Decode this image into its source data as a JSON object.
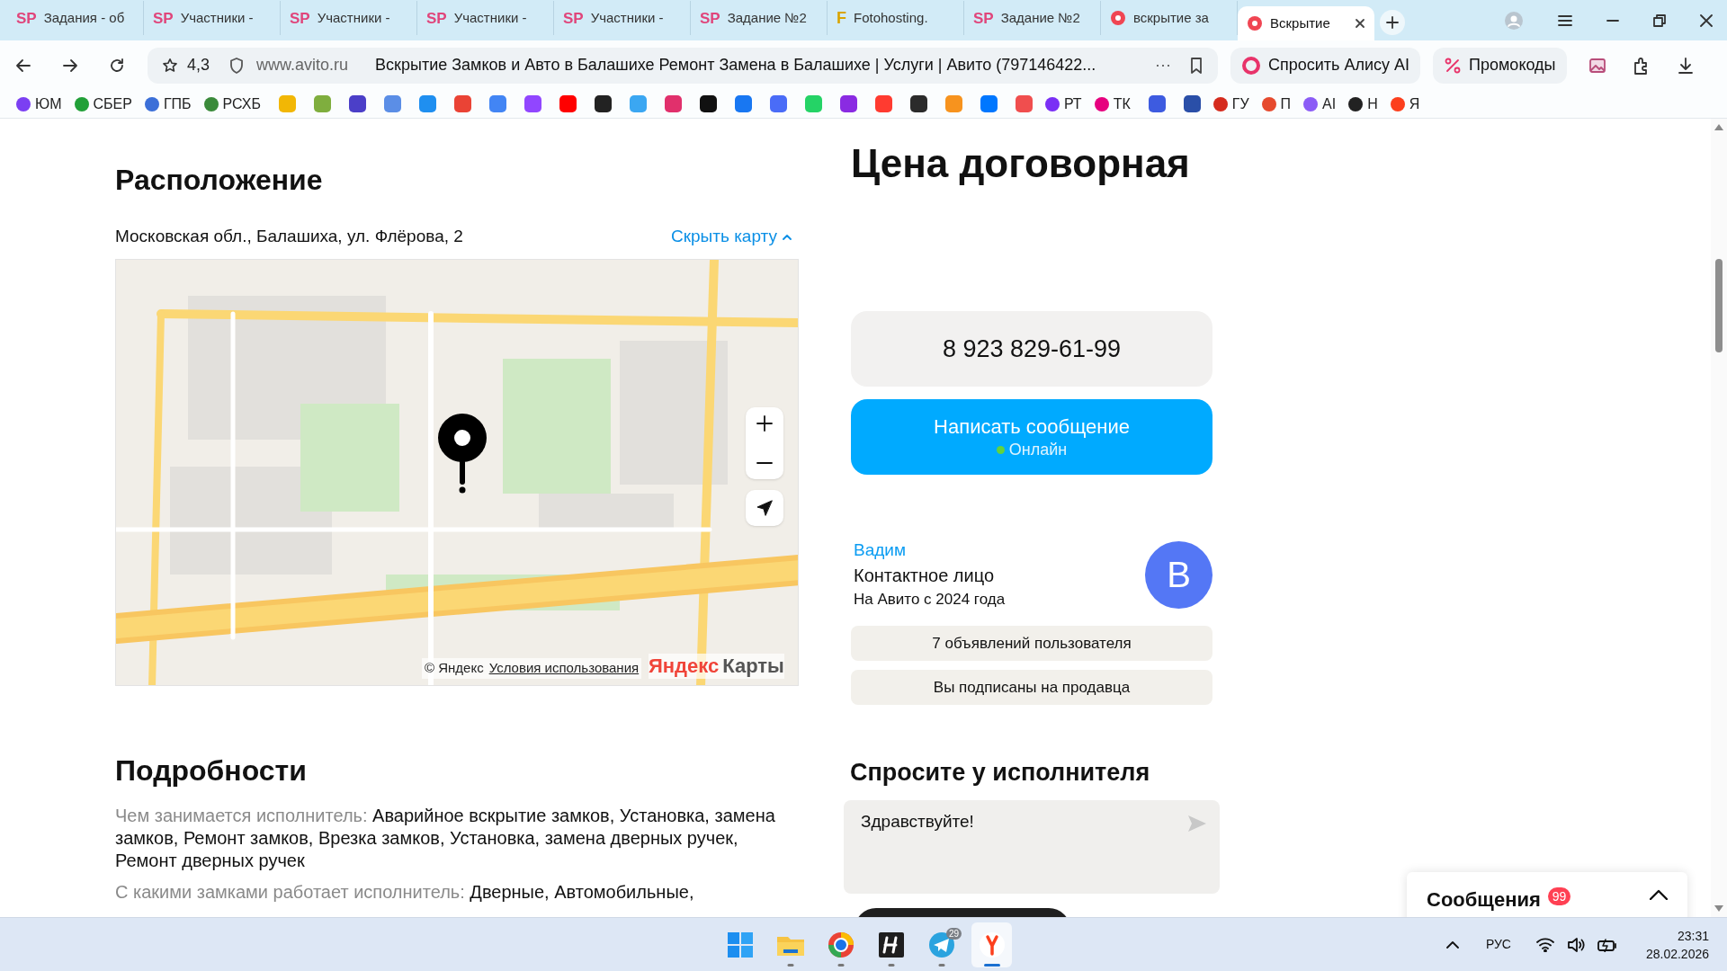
{
  "browser": {
    "tabs": [
      {
        "kind": "text",
        "icon_text": "SP",
        "label": "Задания - об",
        "selected": false
      },
      {
        "kind": "text",
        "icon_text": "SP",
        "label": "Участники -",
        "selected": false
      },
      {
        "kind": "text",
        "icon_text": "SP",
        "label": "Участники -",
        "selected": false
      },
      {
        "kind": "text",
        "icon_text": "SP",
        "label": "Участники -",
        "selected": false
      },
      {
        "kind": "text",
        "icon_text": "SP",
        "label": "Участники -",
        "selected": false
      },
      {
        "kind": "text",
        "icon_text": "SP",
        "label": "Задание №2",
        "selected": false
      },
      {
        "kind": "text",
        "icon_text": "F",
        "label": "Fotohosting.",
        "selected": false
      },
      {
        "kind": "text",
        "icon_text": "SP",
        "label": "Задание №2",
        "selected": false
      },
      {
        "kind": "dot",
        "label": "вскрытие за",
        "selected": false
      },
      {
        "kind": "dot",
        "label": "Вскрытие",
        "selected": true
      }
    ],
    "toolbar": {
      "rating": "4,3",
      "domain": "www.avito.ru",
      "page_title": "Вскрытие Замков и Авто в Балашихе Ремонт Замена в Балашихе | Услуги | Авито (797146422...",
      "more": "···",
      "alice_button": "Спросить Алису AI",
      "promo_button": "Промокоды"
    },
    "bookmarks": [
      {
        "label": "ЮМ",
        "color": "#7b3ff2"
      },
      {
        "label": "СБЕР",
        "color": "#21a038"
      },
      {
        "label": "ГПБ",
        "color": "#3b6fd8"
      },
      {
        "label": "РСХБ",
        "color": "#3a8a3a"
      },
      {
        "color": "#f2b705"
      },
      {
        "color": "#7fae3e"
      },
      {
        "color": "#4b3fc8"
      },
      {
        "color": "#5b8ee6"
      },
      {
        "color": "#1f8ff0"
      },
      {
        "color": "#ea4335"
      },
      {
        "color": "#4285f4"
      },
      {
        "color": "#9146ff"
      },
      {
        "color": "#ff0000"
      },
      {
        "color": "#222222"
      },
      {
        "color": "#3ba7f2"
      },
      {
        "color": "#e1306c"
      },
      {
        "color": "#111111"
      },
      {
        "color": "#1877f2"
      },
      {
        "color": "#4a6cf7"
      },
      {
        "color": "#25d366"
      },
      {
        "color": "#8a2be2"
      },
      {
        "color": "#ff3b30"
      },
      {
        "color": "#2b2b2b"
      },
      {
        "color": "#f7931e"
      },
      {
        "color": "#0077ff"
      },
      {
        "color": "#f04e4e"
      },
      {
        "label": "РТ",
        "color": "#7a2ff5"
      },
      {
        "label": "ТК",
        "color": "#e6007e"
      },
      {
        "color": "#3d5be0"
      },
      {
        "color": "#2a4fa8"
      },
      {
        "label": "ГУ",
        "color": "#d52b1e"
      },
      {
        "label": "П",
        "color": "#e64a2e"
      },
      {
        "label": "AI",
        "color": "#8b5cf6"
      },
      {
        "label": "Н",
        "color": "#222222"
      },
      {
        "label": "Я",
        "color": "#fc3f1d"
      }
    ]
  },
  "location": {
    "heading": "Расположение",
    "address": "Московская обл., Балашиха, ул. Флёрова, 2",
    "toggle_link": "Скрыть карту",
    "map": {
      "attribution": "© Яндекс",
      "terms_link": "Условия использования",
      "logo": [
        "Яндекс",
        "Карты"
      ]
    }
  },
  "details": {
    "heading": "Подробности",
    "items": [
      {
        "label": "Чем занимается исполнитель:",
        "value": "Аварийное вскрытие замков, Установка, замена замков, Ремонт замков, Врезка замков, Установка, замена дверных ручек, Ремонт дверных ручек"
      },
      {
        "label": "С какими замками работает исполнитель:",
        "value": "Дверные, Автомобильные,"
      }
    ]
  },
  "price": "Цена договорная",
  "phone_button": "8 923 829-61-99",
  "message_button": {
    "label": "Написать сообщение",
    "status": "Онлайн",
    "online": true
  },
  "seller": {
    "name": "Вадим",
    "role": "Контактное лицо",
    "since": "На Авито с 2024 года",
    "avatar_letter": "В"
  },
  "seller_buttons": [
    "7 объявлений пользователя",
    "Вы подписаны на продавца"
  ],
  "ask": {
    "heading": "Спросите у исполнителя",
    "message": "Здравствуйте!"
  },
  "messages_panel": {
    "title": "Сообщения",
    "badge": "99",
    "expanded": false
  },
  "taskbar": {
    "apps": [
      {
        "kind": "start",
        "running": false,
        "active": false
      },
      {
        "kind": "folder",
        "running": true,
        "active": false
      },
      {
        "kind": "browser",
        "running": true,
        "active": false
      },
      {
        "kind": "h",
        "running": true,
        "active": false
      },
      {
        "kind": "messenger",
        "running": true,
        "active": false,
        "badge": "29"
      },
      {
        "kind": "yandex",
        "running": true,
        "active": true
      }
    ],
    "language": "РУС",
    "time": "23:31",
    "date": "28.02.2026"
  }
}
